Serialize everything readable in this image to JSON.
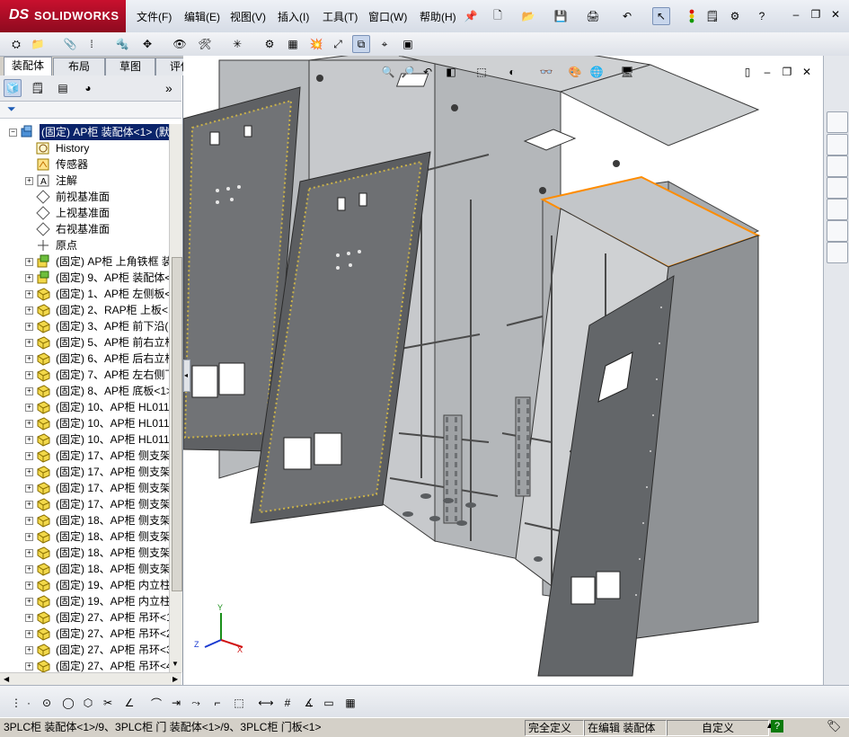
{
  "app": {
    "logo_ds": "DS",
    "logo_text": "SOLIDWORKS"
  },
  "menu": [
    "文件(F)",
    "编辑(E)",
    "视图(V)",
    "插入(I)",
    "工具(T)",
    "窗口(W)",
    "帮助(H)"
  ],
  "cm_tabs": [
    {
      "label": "装配体",
      "active": true
    },
    {
      "label": "布局",
      "active": false
    },
    {
      "label": "草图",
      "active": false
    },
    {
      "label": "评估",
      "active": false
    }
  ],
  "panel": {
    "filter_icon": "filter-icon",
    "expand_glyph": "»"
  },
  "tree": [
    {
      "label": "(固定) AP柜 装配体<1> (默认",
      "pm": "-",
      "icon": "assembly",
      "selected": true,
      "indent": 0
    },
    {
      "label": "History",
      "pm": "",
      "icon": "history",
      "indent": 1
    },
    {
      "label": "传感器",
      "pm": "",
      "icon": "sensor",
      "indent": 1
    },
    {
      "label": "注解",
      "pm": "+",
      "icon": "annotation",
      "indent": 1
    },
    {
      "label": "前视基准面",
      "pm": "",
      "icon": "plane",
      "indent": 1
    },
    {
      "label": "上视基准面",
      "pm": "",
      "icon": "plane",
      "indent": 1
    },
    {
      "label": "右视基准面",
      "pm": "",
      "icon": "plane",
      "indent": 1
    },
    {
      "label": "原点",
      "pm": "",
      "icon": "origin",
      "indent": 1
    },
    {
      "label": "(固定) AP柜 上角铁框 装",
      "pm": "+",
      "icon": "subasm",
      "indent": 1
    },
    {
      "label": "(固定) 9、AP柜 装配体<",
      "pm": "+",
      "icon": "subasm",
      "indent": 1
    },
    {
      "label": "(固定) 1、AP柜 左侧板<",
      "pm": "+",
      "icon": "part",
      "indent": 1
    },
    {
      "label": "(固定) 2、RAP柜 上板<1",
      "pm": "+",
      "icon": "part",
      "indent": 1
    },
    {
      "label": "(固定) 3、AP柜 前下沿(",
      "pm": "+",
      "icon": "part",
      "indent": 1
    },
    {
      "label": "(固定) 5、AP柜 前右立柱",
      "pm": "+",
      "icon": "part",
      "indent": 1
    },
    {
      "label": "(固定) 6、AP柜 后右立柱",
      "pm": "+",
      "icon": "part",
      "indent": 1
    },
    {
      "label": "(固定) 7、AP柜 左右侧下",
      "pm": "+",
      "icon": "part",
      "indent": 1
    },
    {
      "label": "(固定) 8、AP柜 底板<1>",
      "pm": "+",
      "icon": "part",
      "indent": 1
    },
    {
      "label": "(固定) 10、AP柜 HL011-",
      "pm": "+",
      "icon": "part",
      "indent": 1
    },
    {
      "label": "(固定) 10、AP柜 HL011-",
      "pm": "+",
      "icon": "part",
      "indent": 1
    },
    {
      "label": "(固定) 10、AP柜 HL011-",
      "pm": "+",
      "icon": "part",
      "indent": 1
    },
    {
      "label": "(固定) 17、AP柜 侧支架",
      "pm": "+",
      "icon": "part",
      "indent": 1
    },
    {
      "label": "(固定) 17、AP柜 侧支架",
      "pm": "+",
      "icon": "part",
      "indent": 1
    },
    {
      "label": "(固定) 17、AP柜 侧支架",
      "pm": "+",
      "icon": "part",
      "indent": 1
    },
    {
      "label": "(固定) 17、AP柜 侧支架",
      "pm": "+",
      "icon": "part",
      "indent": 1
    },
    {
      "label": "(固定) 18、AP柜 侧支架",
      "pm": "+",
      "icon": "part",
      "indent": 1
    },
    {
      "label": "(固定) 18、AP柜 侧支架",
      "pm": "+",
      "icon": "part",
      "indent": 1
    },
    {
      "label": "(固定) 18、AP柜 侧支架",
      "pm": "+",
      "icon": "part",
      "indent": 1
    },
    {
      "label": "(固定) 18、AP柜 侧支架",
      "pm": "+",
      "icon": "part",
      "indent": 1
    },
    {
      "label": "(固定) 19、AP柜 内立柱",
      "pm": "+",
      "icon": "part",
      "indent": 1
    },
    {
      "label": "(固定) 19、AP柜 内立柱",
      "pm": "+",
      "icon": "part",
      "indent": 1
    },
    {
      "label": "(固定) 27、AP柜 吊环<1",
      "pm": "+",
      "icon": "part",
      "indent": 1
    },
    {
      "label": "(固定) 27、AP柜 吊环<2",
      "pm": "+",
      "icon": "part",
      "indent": 1
    },
    {
      "label": "(固定) 27、AP柜 吊环<3",
      "pm": "+",
      "icon": "part",
      "indent": 1
    },
    {
      "label": "(固定) 27、AP柜 吊环<4",
      "pm": "+",
      "icon": "part",
      "indent": 1
    }
  ],
  "triad": {
    "x": "X",
    "y": "Y",
    "z": "Z"
  },
  "status": {
    "message": "3PLC柜 装配体<1>/9、3PLC柜 门 装配体<1>/9、3PLC柜 门板<1>",
    "fully_defined": "完全定义",
    "editing": "在编辑 装配体",
    "units": "自定义",
    "help": "?"
  },
  "colors": {
    "accent": "#0a246a",
    "brand": "#c8102e",
    "part_yellow": "#f2d84a",
    "edge_orange": "#ff8c00"
  }
}
